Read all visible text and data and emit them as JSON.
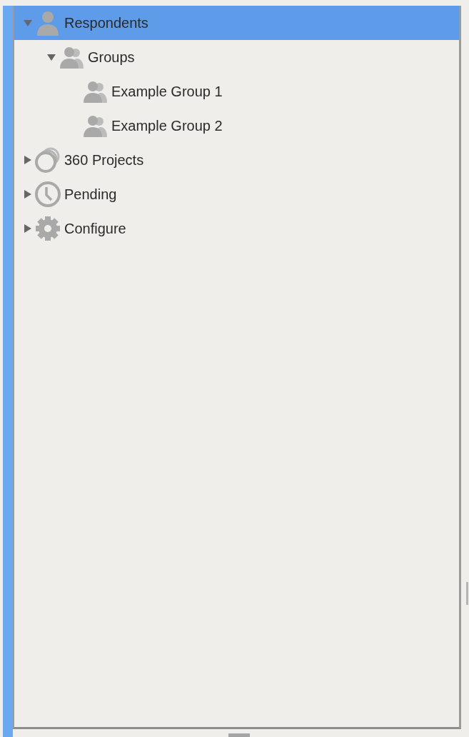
{
  "tree": [
    {
      "label": "Respondents",
      "kind": "person",
      "selected": true,
      "expanded": true,
      "children": [
        {
          "label": "Groups",
          "kind": "group",
          "selected": false,
          "expanded": true,
          "children": [
            {
              "label": "Example Group 1",
              "kind": "group",
              "selected": false
            },
            {
              "label": "Example Group 2",
              "kind": "group",
              "selected": false
            }
          ]
        }
      ]
    },
    {
      "label": "360 Projects",
      "kind": "rings",
      "selected": false,
      "expanded": false
    },
    {
      "label": "Pending",
      "kind": "clock",
      "selected": false,
      "expanded": false
    },
    {
      "label": "Configure",
      "kind": "gear",
      "selected": false,
      "expanded": false
    }
  ]
}
